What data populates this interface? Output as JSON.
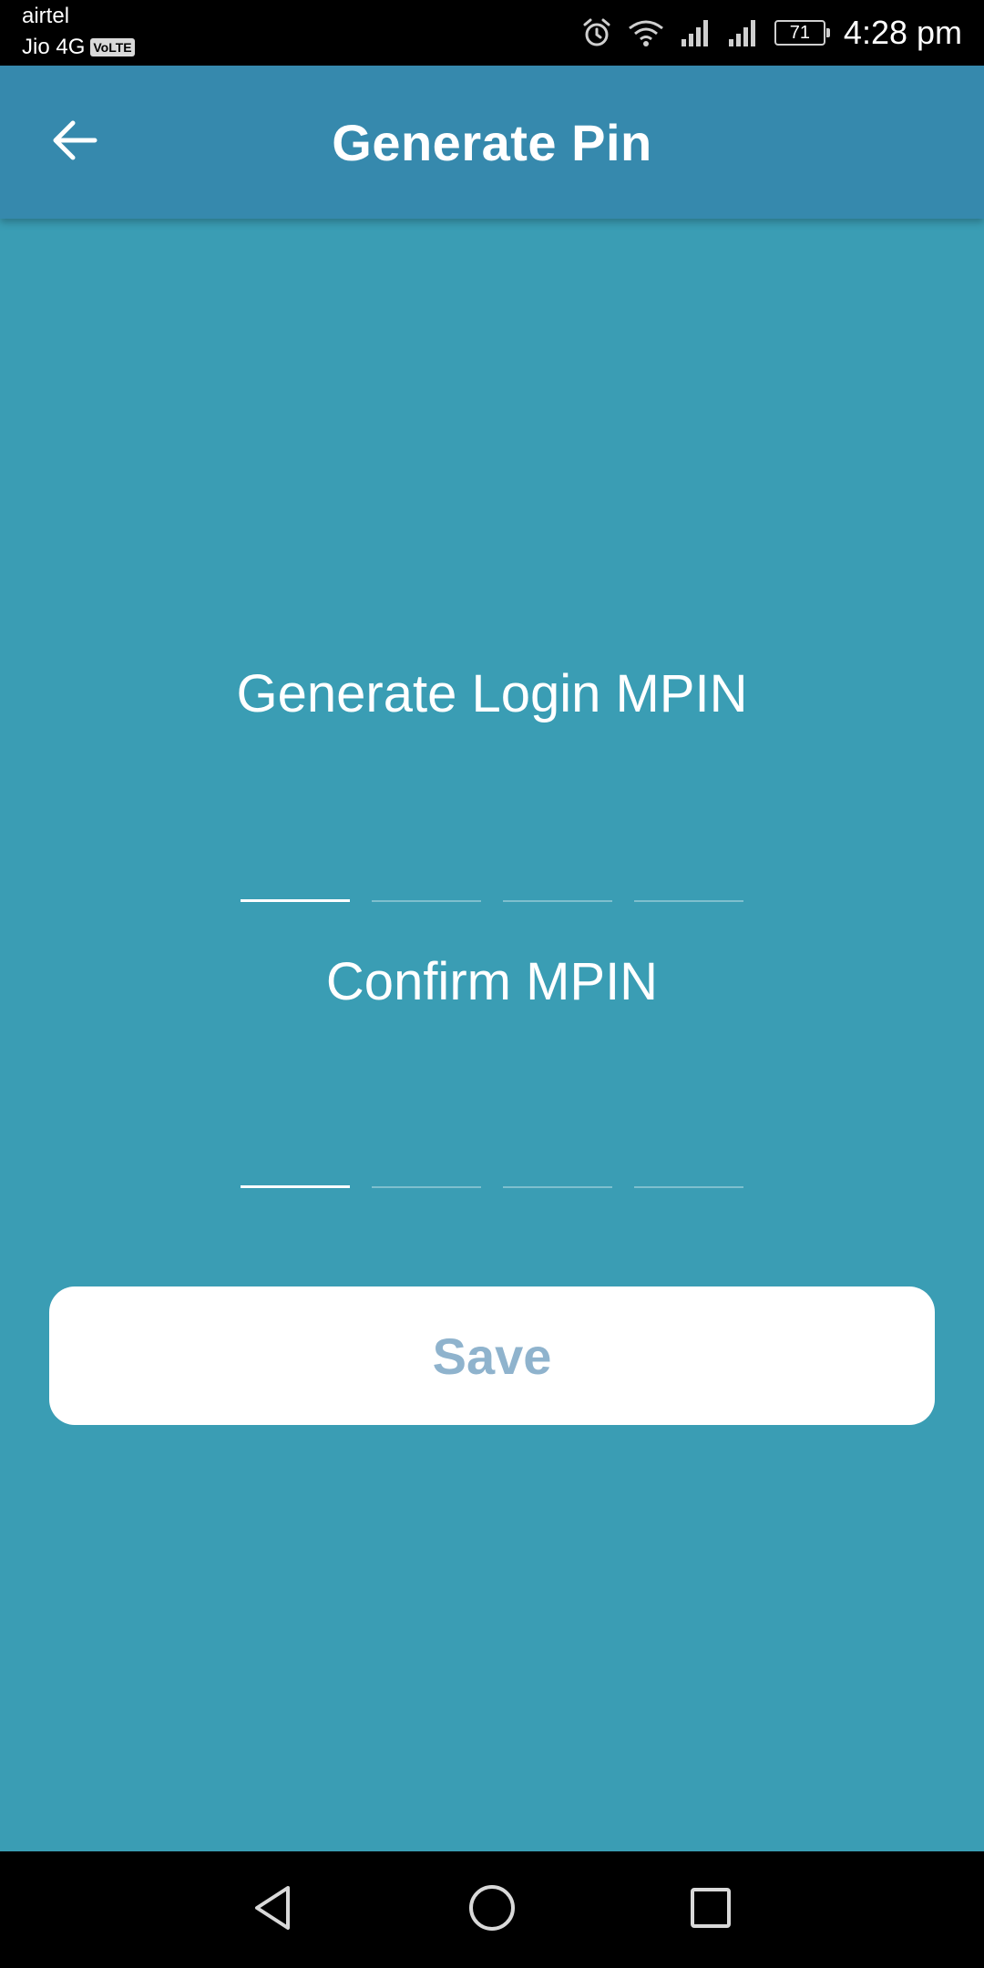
{
  "status_bar": {
    "carrier_primary": "airtel",
    "carrier_secondary": "Jio 4G",
    "volte_label": "VoLTE",
    "battery_level": "71",
    "time": "4:28 pm",
    "icons": [
      "alarm-icon",
      "wifi-icon",
      "signal-icon",
      "signal-icon",
      "battery-icon"
    ]
  },
  "app_bar": {
    "title": "Generate Pin",
    "back_icon": "arrow-left-icon"
  },
  "generate_section": {
    "label": "Generate Login MPIN",
    "pin_length": 4,
    "values": [
      "",
      "",
      "",
      ""
    ],
    "active_index": 0
  },
  "confirm_section": {
    "label": "Confirm MPIN",
    "pin_length": 4,
    "values": [
      "",
      "",
      "",
      ""
    ],
    "active_index": 0
  },
  "save_button": {
    "label": "Save"
  },
  "nav_bar": {
    "icons": [
      "triangle-back-icon",
      "circle-home-icon",
      "square-recents-icon"
    ]
  },
  "colors": {
    "background": "#3a9db4",
    "app_bar": "#3689ad",
    "save_text": "#8fb3cd",
    "white": "#ffffff",
    "black": "#000000"
  }
}
